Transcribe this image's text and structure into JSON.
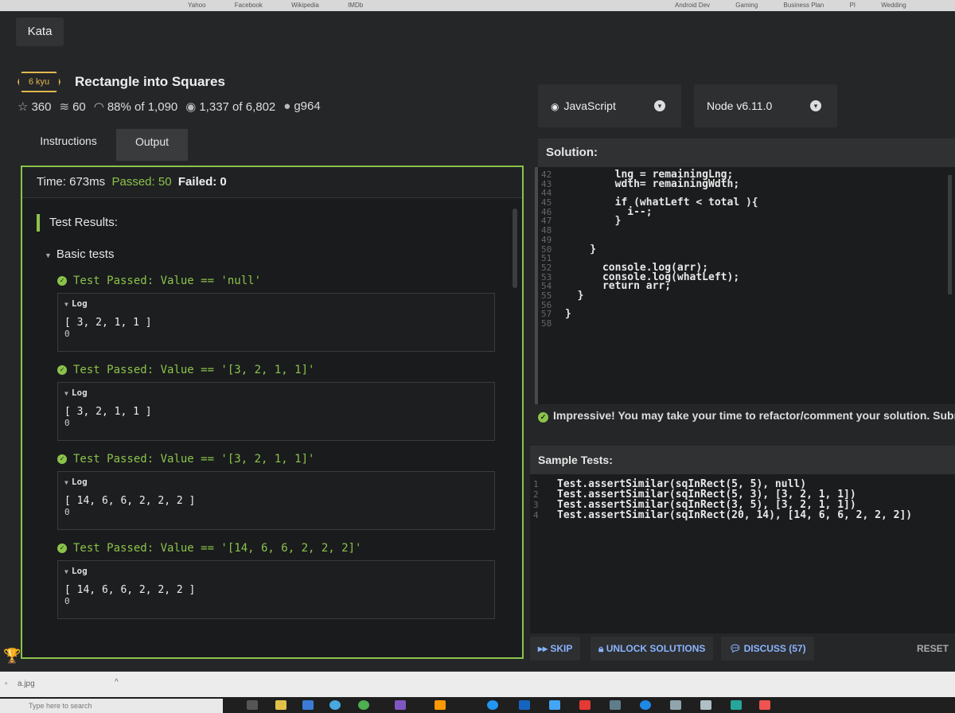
{
  "browser": {
    "bookmarks": [
      "Yahoo",
      "Facebook",
      "Wikipedia",
      "IMDb",
      "Android Dev",
      "Gaming",
      "Business Plan",
      "PI",
      "Wedding"
    ]
  },
  "app": {
    "tab_label": "Kata",
    "kata": {
      "rank": "6 kyu",
      "title": "Rectangle into Squares",
      "stats": {
        "stars": "360",
        "collections": "60",
        "satisfaction": "88% of 1,090",
        "completed": "1,337 of 6,802",
        "author": "g964"
      }
    },
    "left_tabs": [
      {
        "label": "Instructions",
        "active": false
      },
      {
        "label": "Output",
        "active": true
      }
    ],
    "output": {
      "time_label": "Time: 673ms",
      "passed_label": "Passed: 50",
      "failed_label": "Failed: 0",
      "results_heading": "Test Results:",
      "group_label": "Basic tests",
      "tests": [
        {
          "passed": "Test Passed: Value == 'null'",
          "log_label": "Log",
          "log_value": "[ 3, 2, 1, 1 ]",
          "log_extra": "0"
        },
        {
          "passed": "Test Passed: Value == '[3, 2, 1, 1]'",
          "log_label": "Log",
          "log_value": "[ 3, 2, 1, 1 ]",
          "log_extra": "0"
        },
        {
          "passed": "Test Passed: Value == '[3, 2, 1, 1]'",
          "log_label": "Log",
          "log_value": "[ 14, 6, 6, 2, 2, 2 ]",
          "log_extra": "0"
        },
        {
          "passed": "Test Passed: Value == '[14, 6, 6, 2, 2, 2]'",
          "log_label": "Log",
          "log_value": "[ 14, 6, 6, 2, 2, 2 ]",
          "log_extra": "0"
        }
      ]
    },
    "language": "JavaScript",
    "runtime": "Node v6.11.0",
    "solution": {
      "heading": "Solution:",
      "lines": [
        {
          "n": "42",
          "code": "        lng = remainingLng;"
        },
        {
          "n": "43",
          "code": "        wdth= remainingWdth;"
        },
        {
          "n": "44",
          "code": ""
        },
        {
          "n": "45",
          "code": "        if (whatLeft < total ){"
        },
        {
          "n": "46",
          "code": "          i--;"
        },
        {
          "n": "47",
          "code": "        }"
        },
        {
          "n": "48",
          "code": ""
        },
        {
          "n": "49",
          "code": ""
        },
        {
          "n": "50",
          "code": "    }"
        },
        {
          "n": "51",
          "code": ""
        },
        {
          "n": "52",
          "code": "      console.log(arr);"
        },
        {
          "n": "53",
          "code": "      console.log(whatLeft);"
        },
        {
          "n": "54",
          "code": "      return arr;"
        },
        {
          "n": "55",
          "code": "  }"
        },
        {
          "n": "56",
          "code": ""
        },
        {
          "n": "57",
          "code": "}"
        },
        {
          "n": "58",
          "code": ""
        }
      ]
    },
    "success_message": "Impressive! You may take your time to refactor/comment your solution. Submit",
    "sample_tests": {
      "heading": "Sample Tests:",
      "lines": [
        {
          "n": "1",
          "code": "Test.assertSimilar(sqInRect(5, 5), null)"
        },
        {
          "n": "2",
          "code": "Test.assertSimilar(sqInRect(5, 3), [3, 2, 1, 1])"
        },
        {
          "n": "3",
          "code": "Test.assertSimilar(sqInRect(3, 5), [3, 2, 1, 1])"
        },
        {
          "n": "4",
          "code": "Test.assertSimilar(sqInRect(20, 14), [14, 6, 6, 2, 2, 2])"
        }
      ]
    },
    "actions": {
      "skip": "SKIP",
      "unlock": "UNLOCK SOLUTIONS",
      "discuss": "DISCUSS (57)",
      "reset": "RESET"
    }
  },
  "status_bar": {
    "download_file": "a.jpg"
  },
  "taskbar": {
    "search_placeholder": "Type here to search"
  }
}
